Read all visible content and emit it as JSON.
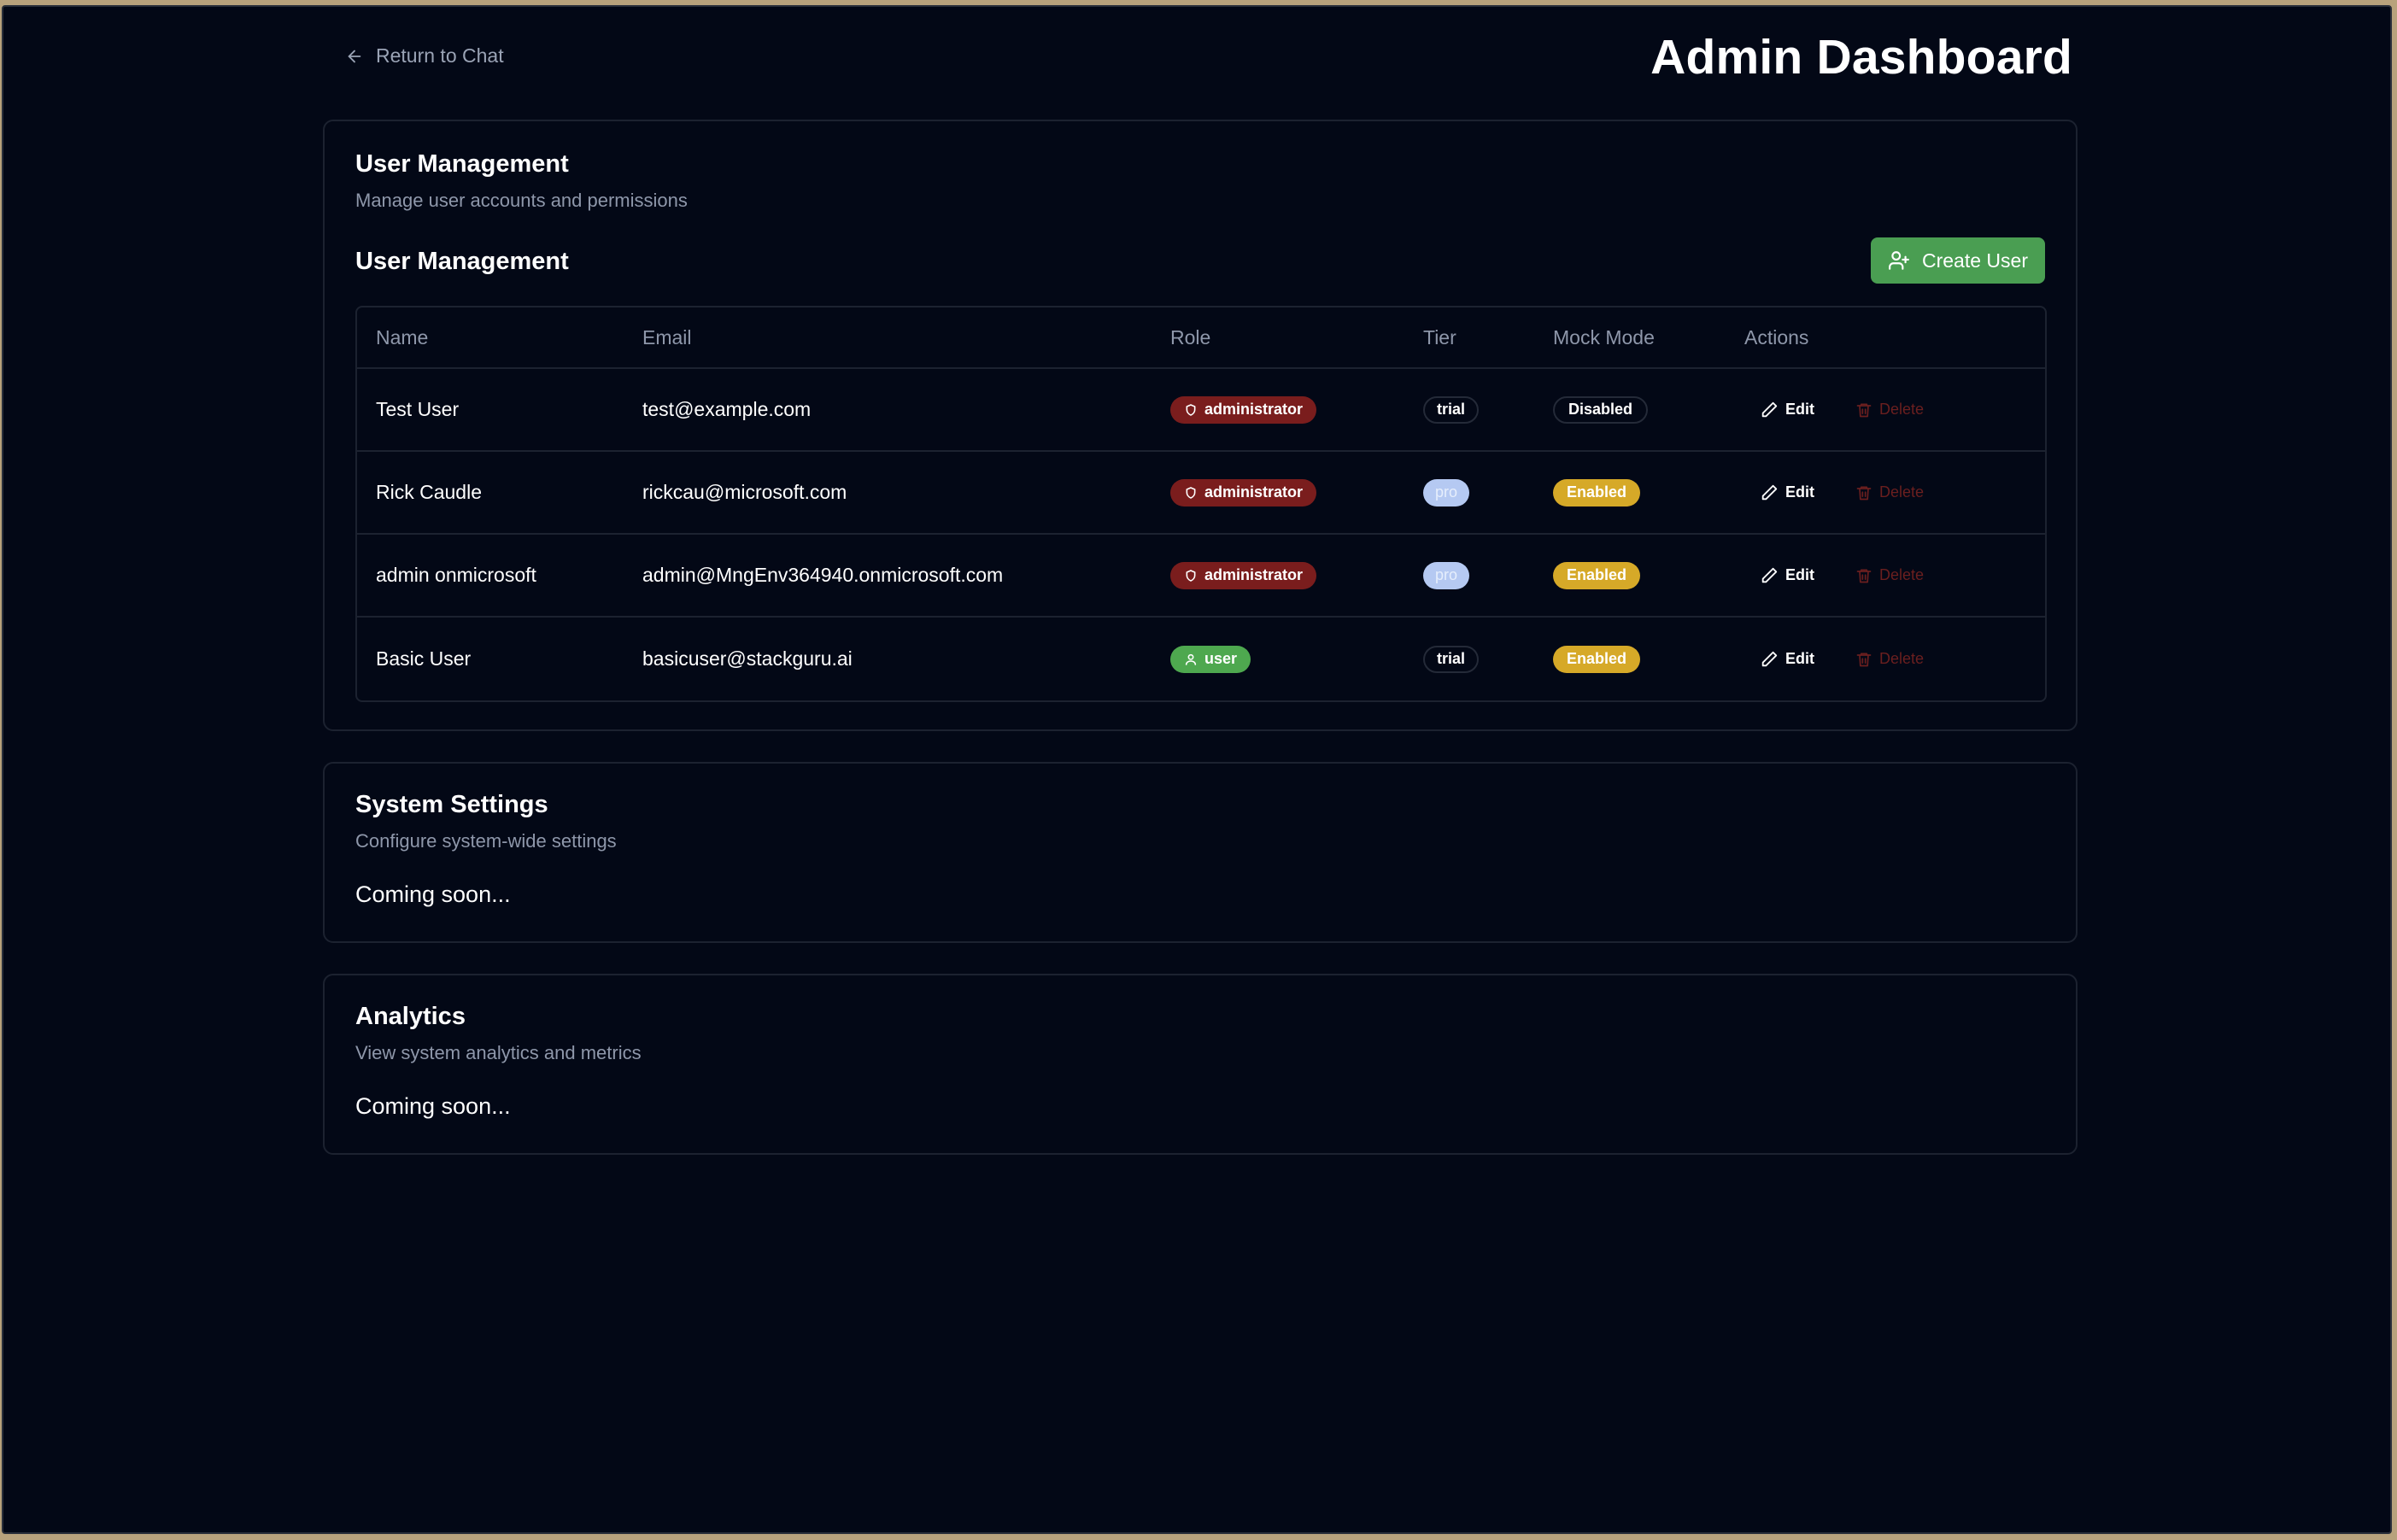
{
  "nav": {
    "back_label": "Return to Chat"
  },
  "header": {
    "title": "Admin Dashboard"
  },
  "user_management": {
    "card_title": "User Management",
    "card_subtitle": "Manage user accounts and permissions",
    "section_title": "User Management",
    "create_button": "Create User",
    "columns": [
      "Name",
      "Email",
      "Role",
      "Tier",
      "Mock Mode",
      "Actions"
    ],
    "rows": [
      {
        "name": "Test User",
        "email": "test@example.com",
        "role": "administrator",
        "tier": "trial",
        "mock": "Disabled"
      },
      {
        "name": "Rick Caudle",
        "email": "rickcau@microsoft.com",
        "role": "administrator",
        "tier": "pro",
        "mock": "Enabled"
      },
      {
        "name": "admin onmicrosoft",
        "email": "admin@MngEnv364940.onmicrosoft.com",
        "role": "administrator",
        "tier": "pro",
        "mock": "Enabled"
      },
      {
        "name": "Basic User",
        "email": "basicuser@stackguru.ai",
        "role": "user",
        "tier": "trial",
        "mock": "Enabled"
      }
    ],
    "edit_label": "Edit",
    "delete_label": "Delete"
  },
  "system_settings": {
    "title": "System Settings",
    "subtitle": "Configure system-wide settings",
    "body": "Coming soon..."
  },
  "analytics": {
    "title": "Analytics",
    "subtitle": "View system analytics and metrics",
    "body": "Coming soon..."
  },
  "colors": {
    "background": "#030816",
    "create_button": "#4a9e52",
    "admin_badge": "#7a1d1d",
    "user_badge": "#4ea84f",
    "pro_badge": "#b5c9f2",
    "enabled_badge": "#d6a928",
    "delete_text": "#6b1f1f"
  }
}
